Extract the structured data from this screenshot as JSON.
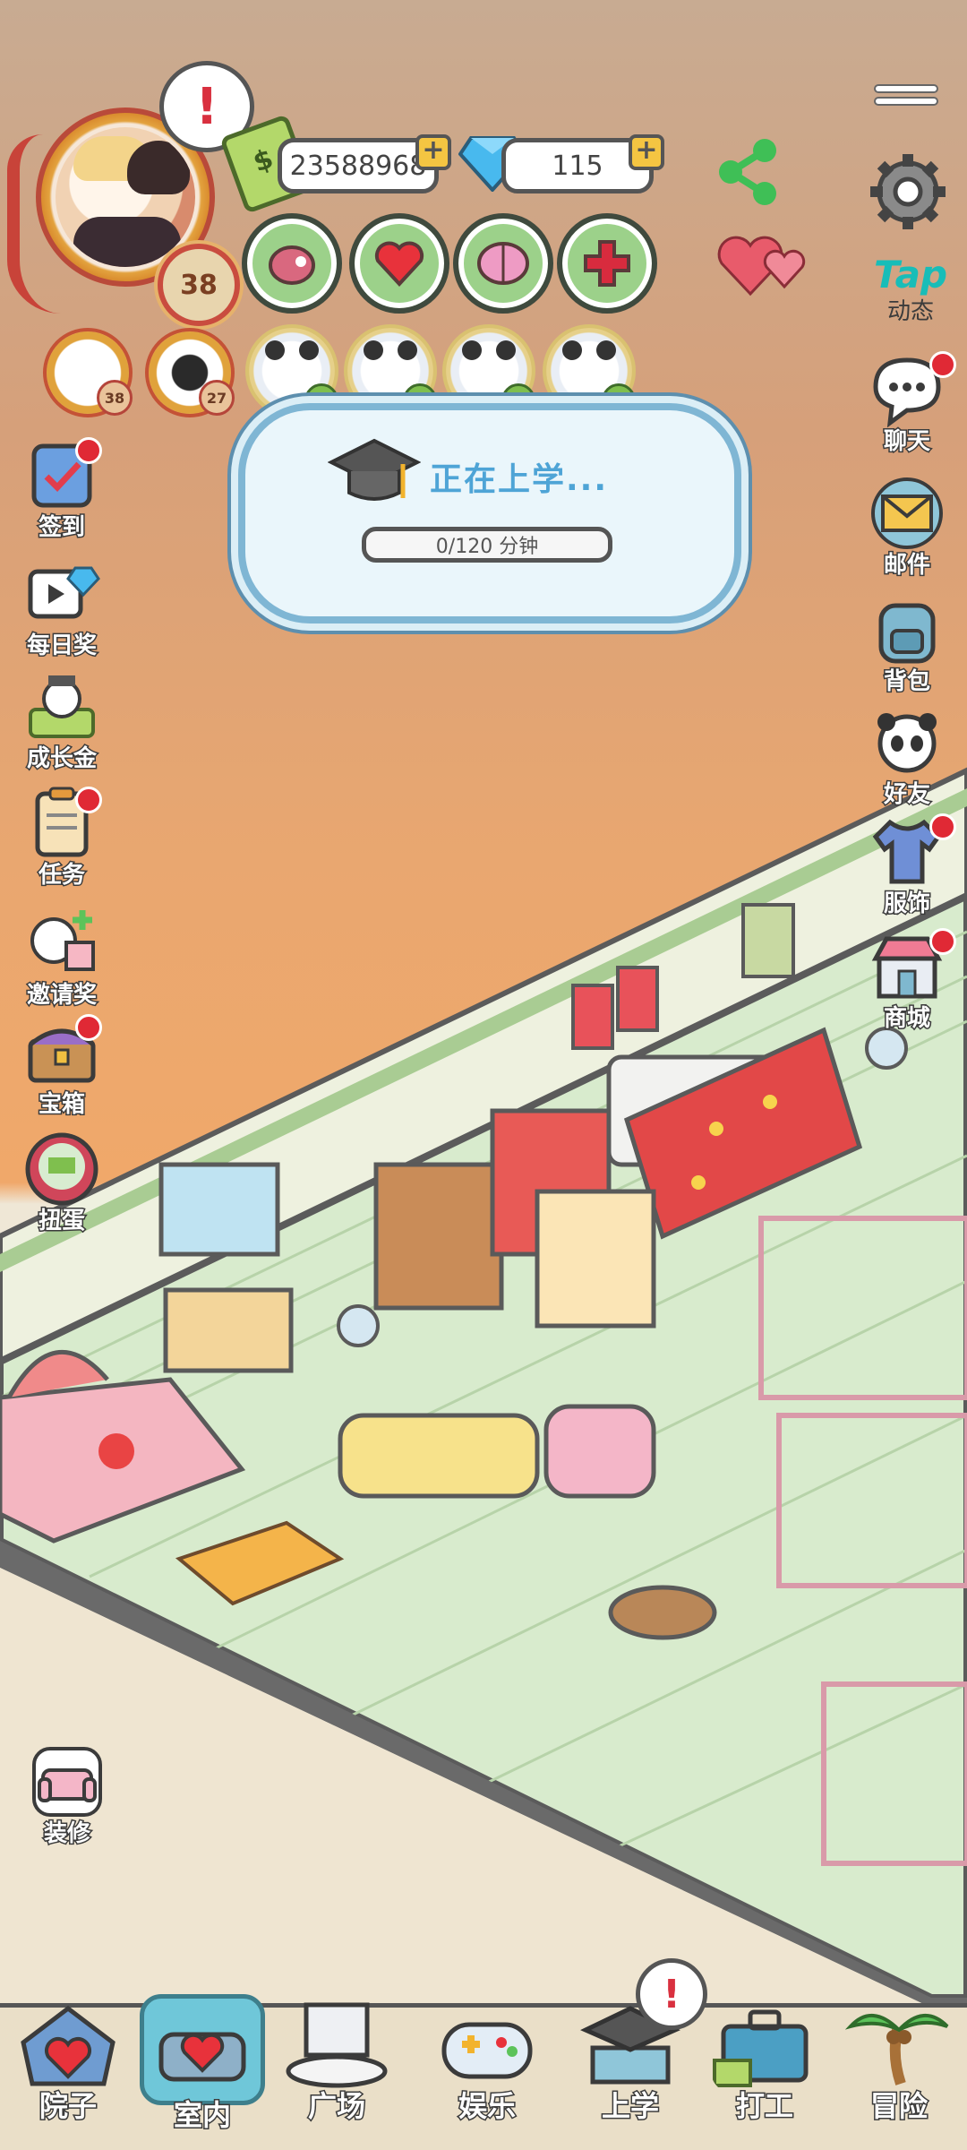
{
  "profile": {
    "level": "38",
    "alert": "!"
  },
  "currency": {
    "cash": "23588968",
    "diamonds": "115"
  },
  "needs": [
    {
      "name": "food"
    },
    {
      "name": "love"
    },
    {
      "name": "brain"
    },
    {
      "name": "health"
    }
  ],
  "family": [
    {
      "level": "38"
    },
    {
      "level": "27"
    }
  ],
  "school": {
    "title": "正在上学...",
    "progress": "0/120 分钟"
  },
  "left_menu": [
    {
      "label": "签到",
      "dot": true
    },
    {
      "label": "每日奖",
      "dot": false
    },
    {
      "label": "成长金",
      "dot": false
    },
    {
      "label": "任务",
      "dot": true
    },
    {
      "label": "邀请奖",
      "dot": false
    },
    {
      "label": "宝箱",
      "dot": true
    },
    {
      "label": "扭蛋",
      "dot": false
    }
  ],
  "decorate": {
    "label": "装修"
  },
  "right_menu": [
    {
      "label": "动态",
      "brand": "Tap"
    },
    {
      "label": "聊天",
      "dot": true
    },
    {
      "label": "邮件",
      "dot": false
    },
    {
      "label": "背包",
      "dot": false
    },
    {
      "label": "好友",
      "dot": false
    },
    {
      "label": "服饰",
      "dot": true
    },
    {
      "label": "商城",
      "dot": true
    }
  ],
  "bottom_nav": [
    {
      "label": "院子"
    },
    {
      "label": "室内",
      "selected": true
    },
    {
      "label": "广场"
    },
    {
      "label": "娱乐"
    },
    {
      "label": "上学",
      "alert": "!"
    },
    {
      "label": "打工"
    },
    {
      "label": "冒险"
    }
  ],
  "colors": {
    "accent": "#6fc7d9",
    "alert": "#e02935",
    "need_bg": "#9cd18a",
    "tap": "#18bdb8"
  }
}
